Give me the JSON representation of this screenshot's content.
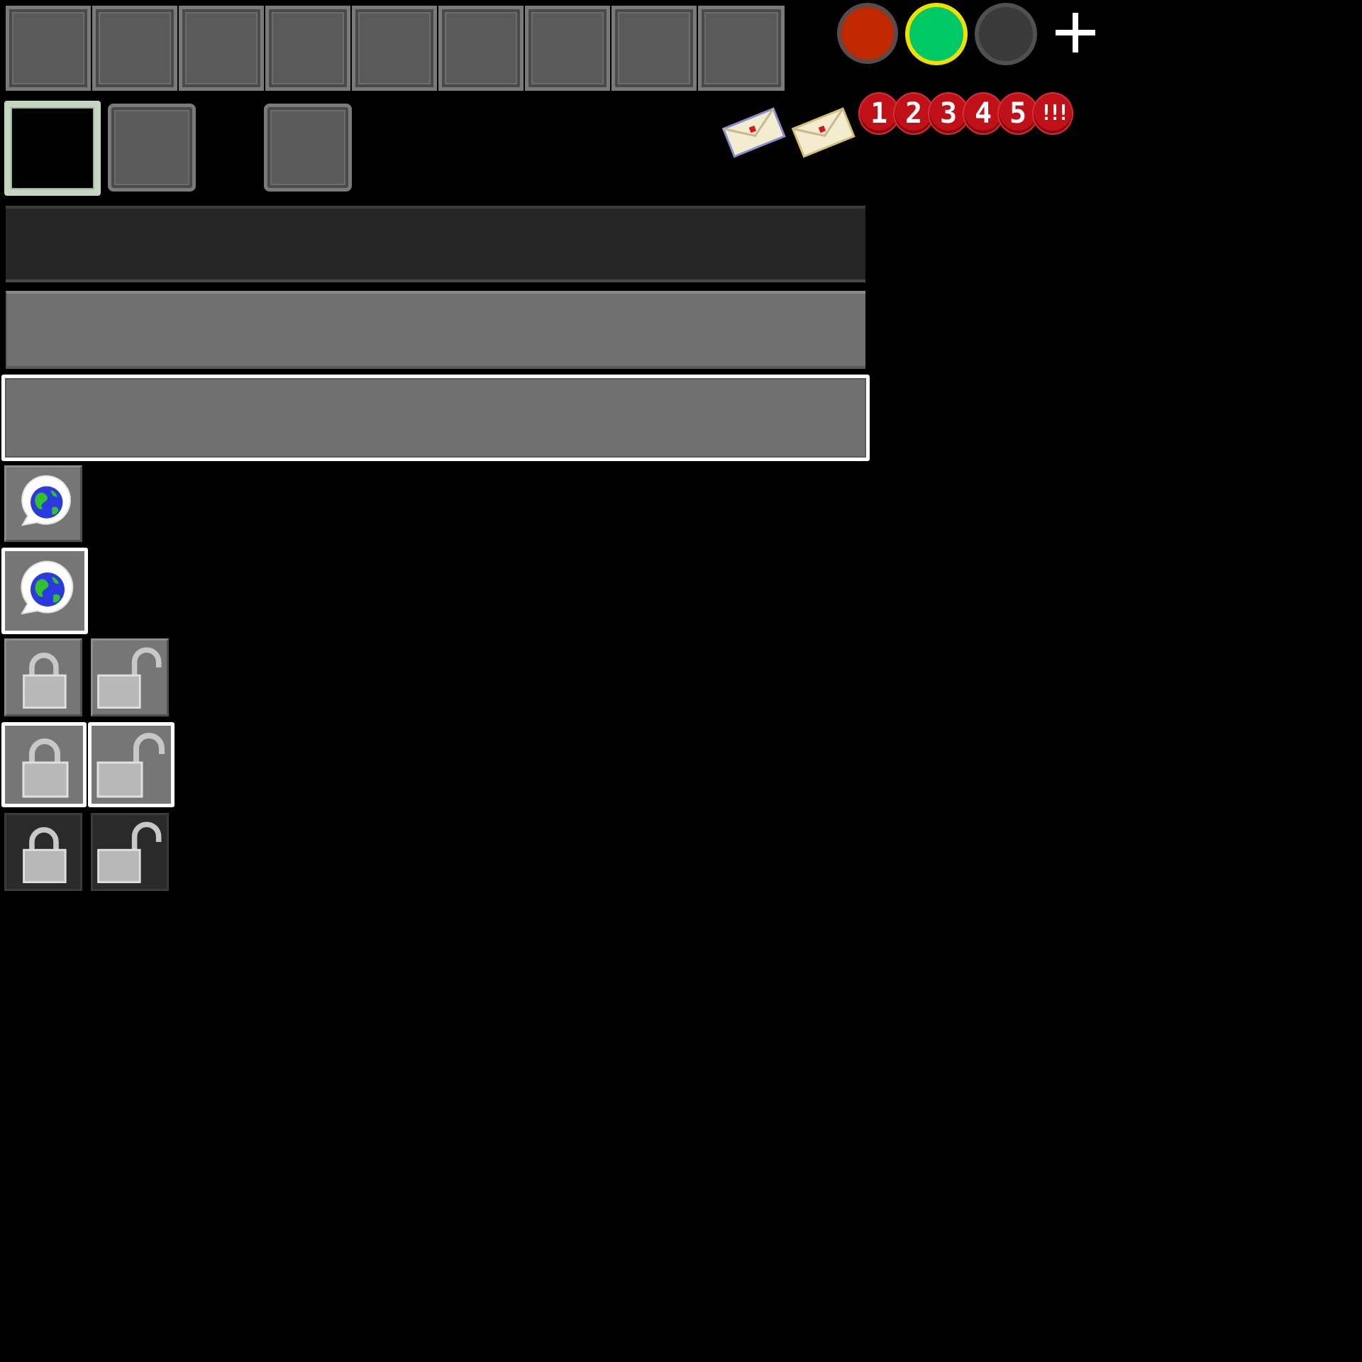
{
  "hotbar": {
    "slot_count": 9
  },
  "status_circles": {
    "colors": [
      "#c02800",
      "#00c864",
      "#3a3a3a"
    ],
    "plus_icon": "plus-icon"
  },
  "notifications": {
    "envelope_icons": [
      "envelope-icon",
      "envelope-icon"
    ],
    "badges": [
      "1",
      "2",
      "3",
      "4",
      "5",
      "!!!"
    ],
    "badge_color": "#c01018"
  },
  "buttons": {
    "world_icon": "globe-chat-icon",
    "locked_icon": "lock-closed-icon",
    "unlocked_icon": "lock-open-icon"
  }
}
